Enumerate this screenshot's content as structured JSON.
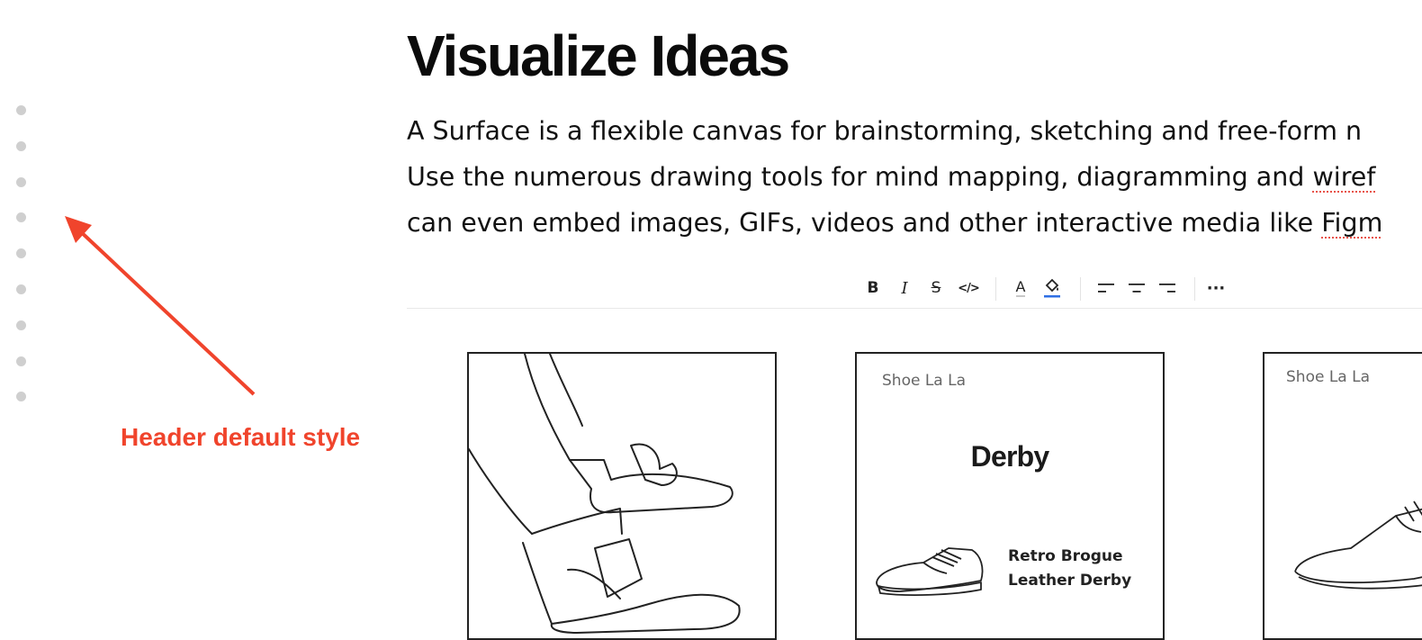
{
  "page": {
    "title": "Visualize Ideas",
    "body_lines": [
      {
        "pre": "A Surface is a flexible canvas for brainstorming, sketching and free-form n",
        "flag": "",
        "post": ""
      },
      {
        "pre": "Use the numerous drawing tools for mind mapping, diagramming and ",
        "flag": "wiref",
        "post": ""
      },
      {
        "pre": "can even embed images, GIFs, videos and other interactive media like ",
        "flag": "Figm",
        "post": ""
      }
    ]
  },
  "annotation": {
    "label": "Header default style",
    "color": "#f0442c"
  },
  "toolbar": {
    "items": [
      {
        "name": "bold-button",
        "icon": "B"
      },
      {
        "name": "italic-button",
        "icon": "I"
      },
      {
        "name": "strikethrough-button",
        "icon": "S"
      },
      {
        "name": "code-button",
        "icon": "</>"
      },
      {
        "name": "text-color-button",
        "icon": "A"
      },
      {
        "name": "highlight-color-button",
        "icon": "fill-bucket-icon"
      },
      {
        "name": "align-left-button",
        "icon": "align-left-icon"
      },
      {
        "name": "align-center-button",
        "icon": "align-center-icon"
      },
      {
        "name": "align-right-button",
        "icon": "align-right-icon"
      },
      {
        "name": "more-options-button",
        "icon": "···"
      }
    ],
    "highlight_color": "#2f6fe4"
  },
  "cards": [
    {
      "brand": "",
      "title": "",
      "caption": []
    },
    {
      "brand": "Shoe La La",
      "title": "Derby",
      "caption": [
        "Retro Brogue",
        "Leather Derby"
      ]
    },
    {
      "brand": "Shoe La La",
      "title": "",
      "caption": []
    }
  ]
}
